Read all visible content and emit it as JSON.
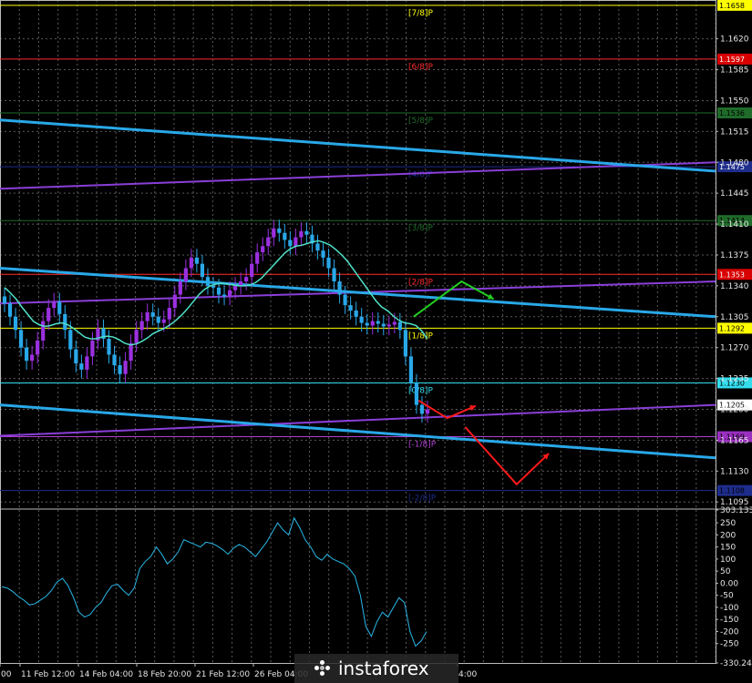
{
  "chart_data": {
    "type": "line",
    "instrument_note": "",
    "price_panel": {
      "y_ticks": [
        "1.1620",
        "1.1585",
        "1.1550",
        "1.1515",
        "1.1480",
        "1.1445",
        "1.1410",
        "1.1375",
        "1.1340",
        "1.1305",
        "1.1270",
        "1.1235",
        "1.1200",
        "1.1165",
        "1.1130",
        "1.1095"
      ],
      "ylim": [
        1.1088,
        1.1664
      ],
      "murrey_levels": [
        {
          "label": "[7/8]P",
          "price": 1.1658,
          "badge": "1.1658",
          "color": "#ffff00",
          "badge_bg": "#ffff00",
          "badge_fg": "#000000"
        },
        {
          "label": "[6/8]P",
          "price": 1.1597,
          "badge": "1.1597",
          "color": "#ff2a2a",
          "badge_bg": "#d80000",
          "badge_fg": "#ffffff"
        },
        {
          "label": "[5/8]P",
          "price": 1.1536,
          "badge": "1.1536",
          "color": "#1f6b2a",
          "badge_bg": "#1f6b2a",
          "badge_fg": "#000000"
        },
        {
          "label": "[4/8]P",
          "price": 1.1475,
          "badge": "1.1475",
          "color": "#1e2d8c",
          "badge_bg": "#1e2d8c",
          "badge_fg": "#ffffff"
        },
        {
          "label": "[3/8]P",
          "price": 1.1414,
          "badge": "1.1414",
          "color": "#1f6b2a",
          "badge_bg": "#1f6b2a",
          "badge_fg": "#000000"
        },
        {
          "label": "[2/8]P",
          "price": 1.1353,
          "badge": "1.1353",
          "color": "#ff2a2a",
          "badge_bg": "#d80000",
          "badge_fg": "#ffffff"
        },
        {
          "label": "[1/8]P",
          "price": 1.1292,
          "badge": "1.1292",
          "color": "#ffff00",
          "badge_bg": "#ffff00",
          "badge_fg": "#000000"
        },
        {
          "label": "[0/8]P",
          "price": 1.123,
          "badge": "1.1230",
          "color": "#33ddee",
          "badge_bg": "#33ddee",
          "badge_fg": "#000000"
        },
        {
          "label": "[-1/8]P",
          "price": 1.1169,
          "badge": "1.1169",
          "color": "#b040d0",
          "badge_bg": "#9a2fc0",
          "badge_fg": "#000000"
        },
        {
          "label": "[-2/8]P",
          "price": 1.1108,
          "badge": "1.1108",
          "color": "#1e2d8c",
          "badge_bg": "#1e2d8c",
          "badge_fg": "#000000"
        }
      ],
      "current_price": "1.1205",
      "close_series": [
        1.132,
        1.1305,
        1.129,
        1.127,
        1.1255,
        1.1262,
        1.1278,
        1.13,
        1.1315,
        1.1322,
        1.1308,
        1.129,
        1.1268,
        1.1252,
        1.1245,
        1.126,
        1.1278,
        1.1292,
        1.128,
        1.1262,
        1.125,
        1.124,
        1.1255,
        1.1275,
        1.129,
        1.13,
        1.131,
        1.1305,
        1.1298,
        1.1302,
        1.1315,
        1.133,
        1.1345,
        1.136,
        1.1372,
        1.1365,
        1.135,
        1.134,
        1.1338,
        1.133,
        1.1328,
        1.1335,
        1.134,
        1.1345,
        1.135,
        1.1365,
        1.1378,
        1.1385,
        1.1395,
        1.1405,
        1.14,
        1.1392,
        1.1385,
        1.1395,
        1.1402,
        1.1398,
        1.1388,
        1.138,
        1.1372,
        1.136,
        1.1345,
        1.133,
        1.1318,
        1.1312,
        1.1305,
        1.1298,
        1.1295,
        1.13,
        1.1297,
        1.1294,
        1.1296,
        1.1299,
        1.129,
        1.126,
        1.123,
        1.1205,
        1.1195,
        1.12
      ],
      "sma_series": [
        1.1338,
        1.1332,
        1.1325,
        1.1316,
        1.1308,
        1.13,
        1.1296,
        1.1294,
        1.1295,
        1.1297,
        1.1298,
        1.1296,
        1.1292,
        1.1287,
        1.1282,
        1.128,
        1.128,
        1.1282,
        1.1283,
        1.1282,
        1.1279,
        1.1275,
        1.1273,
        1.1274,
        1.1277,
        1.1281,
        1.1286,
        1.1289,
        1.1292,
        1.1296,
        1.1301,
        1.1307,
        1.1314,
        1.1322,
        1.133,
        1.1336,
        1.134,
        1.1342,
        1.1343,
        1.1342,
        1.1341,
        1.134,
        1.134,
        1.1341,
        1.1344,
        1.1349,
        1.1356,
        1.1363,
        1.137,
        1.1377,
        1.1382,
        1.1385,
        1.1386,
        1.1388,
        1.139,
        1.1391,
        1.1389,
        1.1386,
        1.1381,
        1.1375,
        1.1368,
        1.1359,
        1.135,
        1.1341,
        1.1332,
        1.1323,
        1.1316,
        1.1312,
        1.1306,
        1.1301,
        1.1298,
        1.1297,
        1.1295,
        1.1289,
        1.128
      ],
      "channel_lines": [
        {
          "from": [
            0,
            1.1528
          ],
          "to": [
            1,
            1.147
          ]
        },
        {
          "from": [
            0,
            1.136
          ],
          "to": [
            1,
            1.1305
          ]
        },
        {
          "from": [
            0,
            1.1205
          ],
          "to": [
            1,
            1.1145
          ]
        }
      ],
      "purple_lines": [
        {
          "from": [
            0,
            1.145
          ],
          "to": [
            1,
            1.148
          ]
        },
        {
          "from": [
            0,
            1.132
          ],
          "to": [
            1,
            1.1345
          ]
        },
        {
          "from": [
            0,
            1.117
          ],
          "to": [
            1,
            1.1205
          ]
        }
      ],
      "forecast_arrows": [
        {
          "color": "#22cc22",
          "points": [
            [
              0.578,
              1.1305
            ],
            [
              0.645,
              1.1345
            ],
            [
              0.69,
              1.1325
            ]
          ]
        },
        {
          "color": "#ff1a1a",
          "points": [
            [
              0.585,
              1.121
            ],
            [
              0.625,
              1.119
            ],
            [
              0.665,
              1.1204
            ]
          ]
        },
        {
          "color": "#ff1a1a",
          "points": [
            [
              0.65,
              1.118
            ],
            [
              0.722,
              1.1115
            ],
            [
              0.767,
              1.115
            ]
          ]
        }
      ]
    },
    "indicator_panel": {
      "y_ticks": [
        "303.133",
        "250",
        "200",
        "150",
        "100",
        "50",
        "0.00",
        "-50",
        "-100",
        "-150",
        "-200",
        "-250",
        "-330.244"
      ],
      "ylim": [
        -330.244,
        303.133
      ],
      "values": [
        -15,
        -20,
        -35,
        -55,
        -70,
        -90,
        -85,
        -70,
        -55,
        -30,
        5,
        20,
        -10,
        -60,
        -120,
        -140,
        -130,
        -100,
        -80,
        -40,
        -10,
        -5,
        -30,
        -50,
        -20,
        60,
        90,
        110,
        150,
        120,
        80,
        100,
        130,
        180,
        170,
        160,
        150,
        170,
        165,
        155,
        140,
        120,
        145,
        160,
        150,
        130,
        110,
        140,
        170,
        210,
        250,
        220,
        200,
        270,
        230,
        180,
        150,
        110,
        95,
        120,
        100,
        90,
        80,
        60,
        30,
        -50,
        -180,
        -220,
        -160,
        -120,
        -140,
        -100,
        -60,
        -80,
        -200,
        -260,
        -240,
        -200
      ]
    },
    "x_ticks": [
      "00",
      "11 Feb 12:00",
      "14 Feb 04:00",
      "18 Feb 20:00",
      "21 Feb 12:00",
      "26 Feb 04:00",
      "4:00"
    ]
  },
  "logo": {
    "text": "instaforex"
  }
}
